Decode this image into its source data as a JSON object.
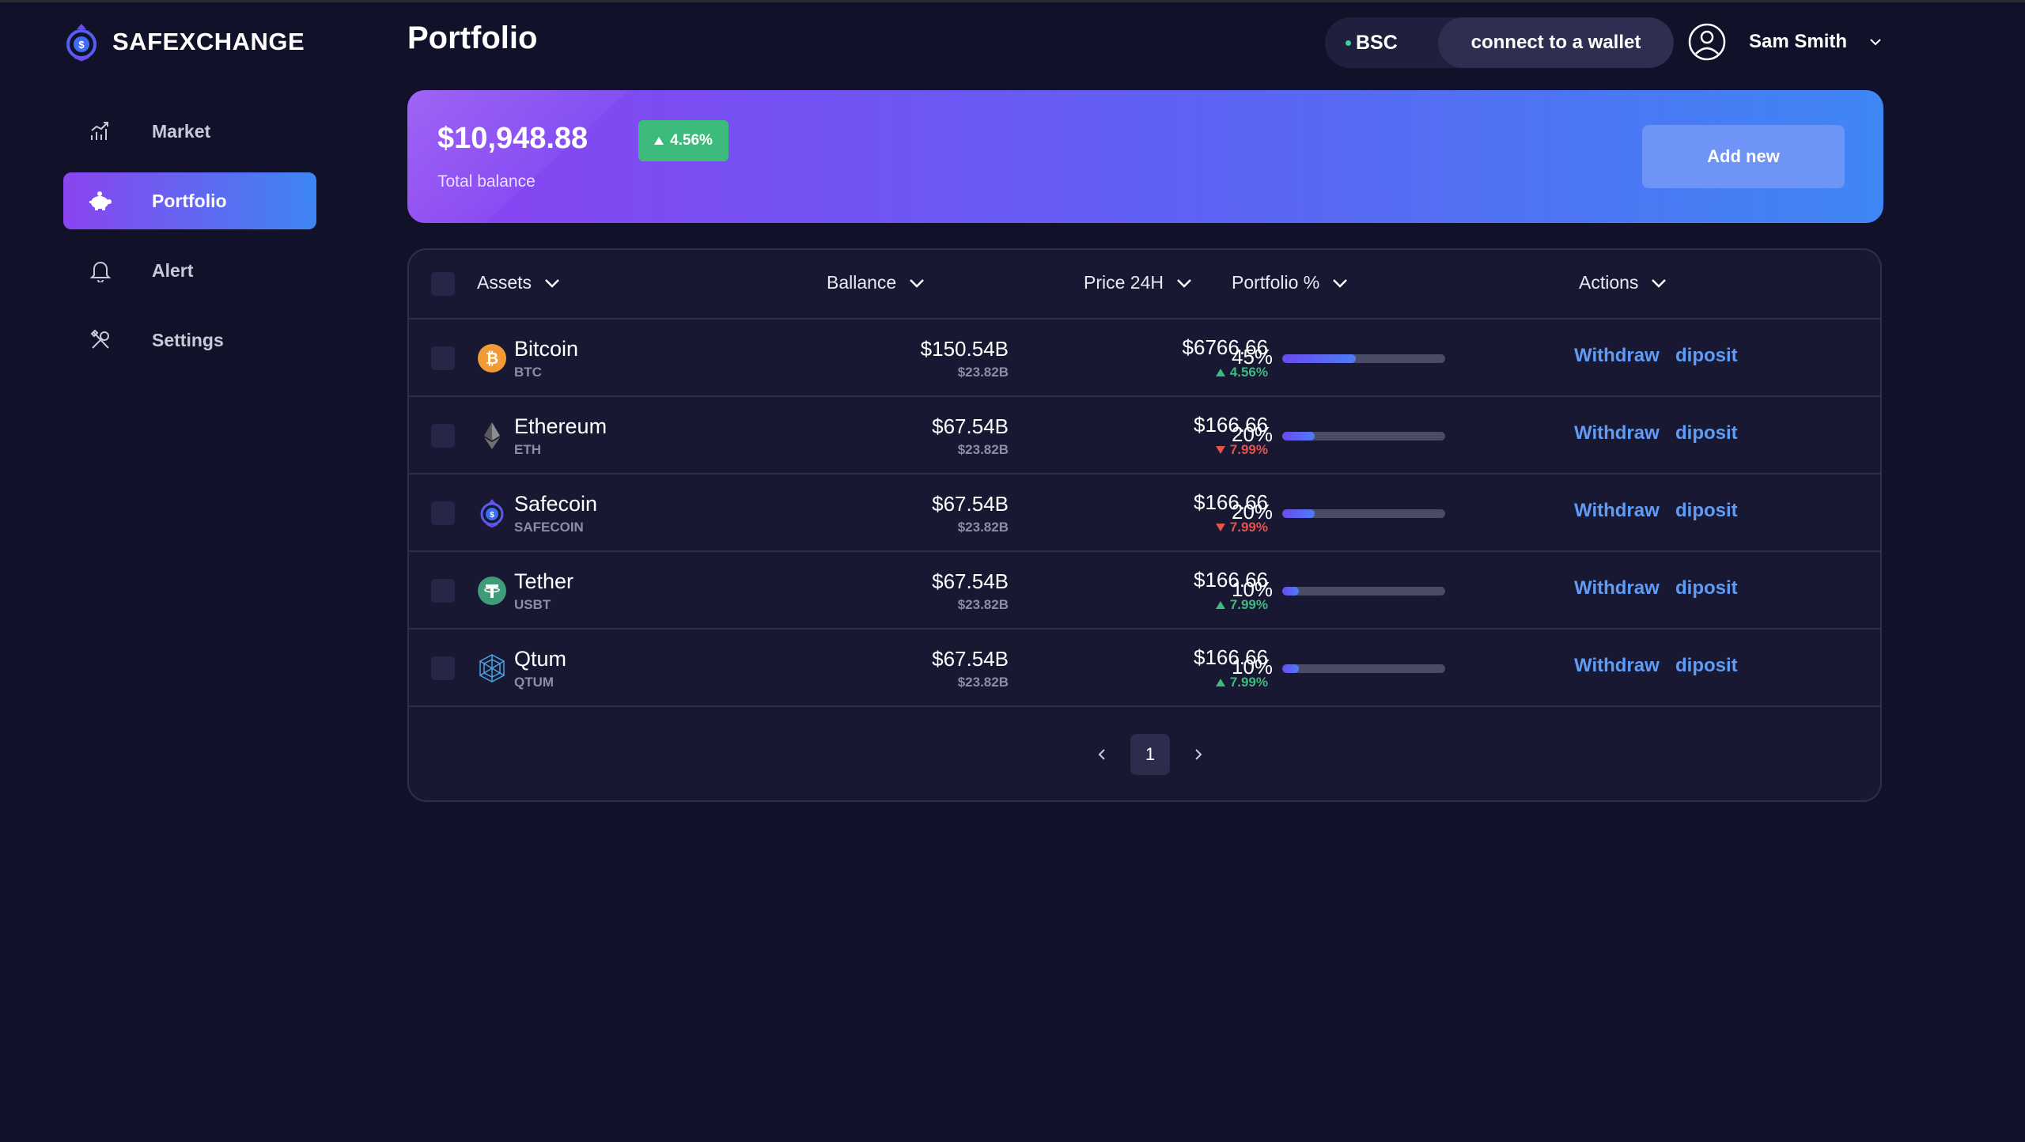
{
  "brand": {
    "name": "SAFEXCHANGE"
  },
  "sidebar": {
    "items": [
      {
        "label": "Market",
        "icon": "chart-icon"
      },
      {
        "label": "Portfolio",
        "icon": "piggy-bank-icon",
        "active": true
      },
      {
        "label": "Alert",
        "icon": "bell-icon"
      },
      {
        "label": "Settings",
        "icon": "tools-icon"
      }
    ]
  },
  "header": {
    "title": "Portfolio",
    "network": "BSC",
    "connect_label": "connect to a wallet",
    "user_name": "Sam Smith"
  },
  "balance": {
    "amount": "$10,948.88",
    "change": "4.56%",
    "label": "Total balance",
    "add_label": "Add new"
  },
  "table": {
    "columns": [
      "Assets",
      "Ballance",
      "Price 24H",
      "Portfolio %",
      "Actions"
    ],
    "rows": [
      {
        "name": "Bitcoin",
        "symbol": "BTC",
        "balance": "$150.54B",
        "balance_sub": "$23.82B",
        "price": "$6766.66",
        "change": "4.56%",
        "direction": "up",
        "portfolio_pct": "45%",
        "portfolio_value": 45,
        "withdraw": "Withdraw",
        "deposit": "diposit",
        "icon": "bitcoin-icon"
      },
      {
        "name": "Ethereum",
        "symbol": "ETH",
        "balance": "$67.54B",
        "balance_sub": "$23.82B",
        "price": "$166.66",
        "change": "7.99%",
        "direction": "down",
        "portfolio_pct": "20%",
        "portfolio_value": 20,
        "withdraw": "Withdraw",
        "deposit": "diposit",
        "icon": "ethereum-icon"
      },
      {
        "name": "Safecoin",
        "symbol": "SAFECOIN",
        "balance": "$67.54B",
        "balance_sub": "$23.82B",
        "price": "$166.66",
        "change": "7.99%",
        "direction": "down",
        "portfolio_pct": "20%",
        "portfolio_value": 20,
        "withdraw": "Withdraw",
        "deposit": "diposit",
        "icon": "safecoin-icon"
      },
      {
        "name": "Tether",
        "symbol": "USBT",
        "balance": "$67.54B",
        "balance_sub": "$23.82B",
        "price": "$166.66",
        "change": "7.99%",
        "direction": "up",
        "portfolio_pct": "10%",
        "portfolio_value": 10,
        "withdraw": "Withdraw",
        "deposit": "diposit",
        "icon": "tether-icon"
      },
      {
        "name": "Qtum",
        "symbol": "QTUM",
        "balance": "$67.54B",
        "balance_sub": "$23.82B",
        "price": "$166.66",
        "change": "7.99%",
        "direction": "up",
        "portfolio_pct": "10%",
        "portfolio_value": 10,
        "withdraw": "Withdraw",
        "deposit": "diposit",
        "icon": "qtum-icon"
      }
    ]
  },
  "pagination": {
    "current": "1"
  },
  "colors": {
    "background": "#11112a",
    "accent_purple": "#8a42f2",
    "accent_blue": "#3f86f5",
    "up": "#3dbb7d",
    "down": "#e5534b",
    "link": "#5f9cf5"
  }
}
